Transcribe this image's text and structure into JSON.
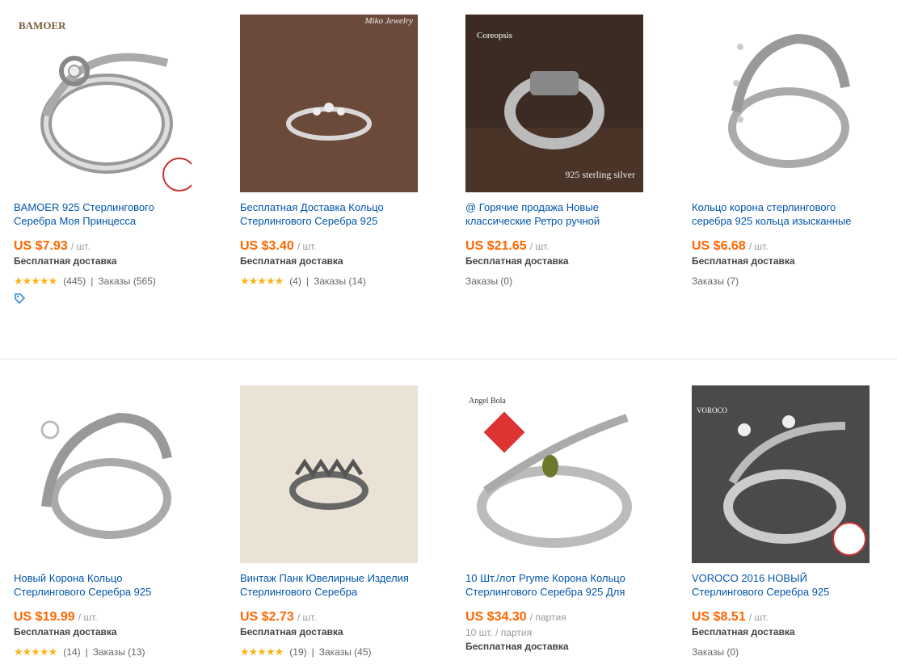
{
  "products": [
    {
      "title": "BAMOER 925 Стерлингового Серебра Моя Принцесса",
      "price": "US $7.93",
      "unit": "/ шт.",
      "shipping": "Бесплатная доставка",
      "stars": "★★★★★",
      "reviews": "(445)",
      "orders": "Заказы (565)",
      "brand": "BAMOER",
      "has_coupon": true
    },
    {
      "title": "Бесплатная Доставка Кольцо Стерлингового Серебра 925",
      "price": "US $3.40",
      "unit": "/ шт.",
      "shipping": "Бесплатная доставка",
      "stars": "★★★★★",
      "reviews": "(4)",
      "orders": "Заказы (14)",
      "brand": "Miko Jewelry"
    },
    {
      "title": "@ Горячие продажа Новые классические Ретро ручной",
      "price": "US $21.65",
      "unit": "/ шт.",
      "shipping": "Бесплатная доставка",
      "orders": "Заказы (0)",
      "brand": "Coreopsis",
      "watermark": "925 sterling silver"
    },
    {
      "title": "Кольцо корона стерлингового серебра 925 кольца изысканные",
      "price": "US $6.68",
      "unit": "/ шт.",
      "shipping": "Бесплатная доставка",
      "orders": "Заказы (7)"
    },
    {
      "title": "Новый Корона Кольцо Стерлингового Серебра 925",
      "price": "US $19.99",
      "unit": "/ шт.",
      "shipping": "Бесплатная доставка",
      "stars": "★★★★★",
      "reviews": "(14)",
      "orders": "Заказы (13)"
    },
    {
      "title": "Винтаж Панк Ювелирные Изделия Стерлингового Серебра",
      "price": "US $2.73",
      "unit": "/ шт.",
      "shipping": "Бесплатная доставка",
      "stars": "★★★★★",
      "reviews": "(19)",
      "orders": "Заказы (45)"
    },
    {
      "title": "10 Шт./лот Pryme Корона Кольцо Стерлингового Серебра 925 Для",
      "price": "US $34.30",
      "unit": "/ партия",
      "lot": "10 шт. / партия",
      "shipping": "Бесплатная доставка",
      "brand": "Angel Bola"
    },
    {
      "title": "VOROCO 2016 НОВЫЙ Стерлингового Серебра 925",
      "price": "US $8.51",
      "unit": "/ шт.",
      "shipping": "Бесплатная доставка",
      "orders": "Заказы (0)",
      "brand": "VOROCO"
    }
  ],
  "colors": {
    "title_link": "#0055aa",
    "price": "#ff6600",
    "stars": "#f8b41c"
  },
  "icons": [
    "ring-image",
    "coupon-icon",
    "star-icon"
  ]
}
